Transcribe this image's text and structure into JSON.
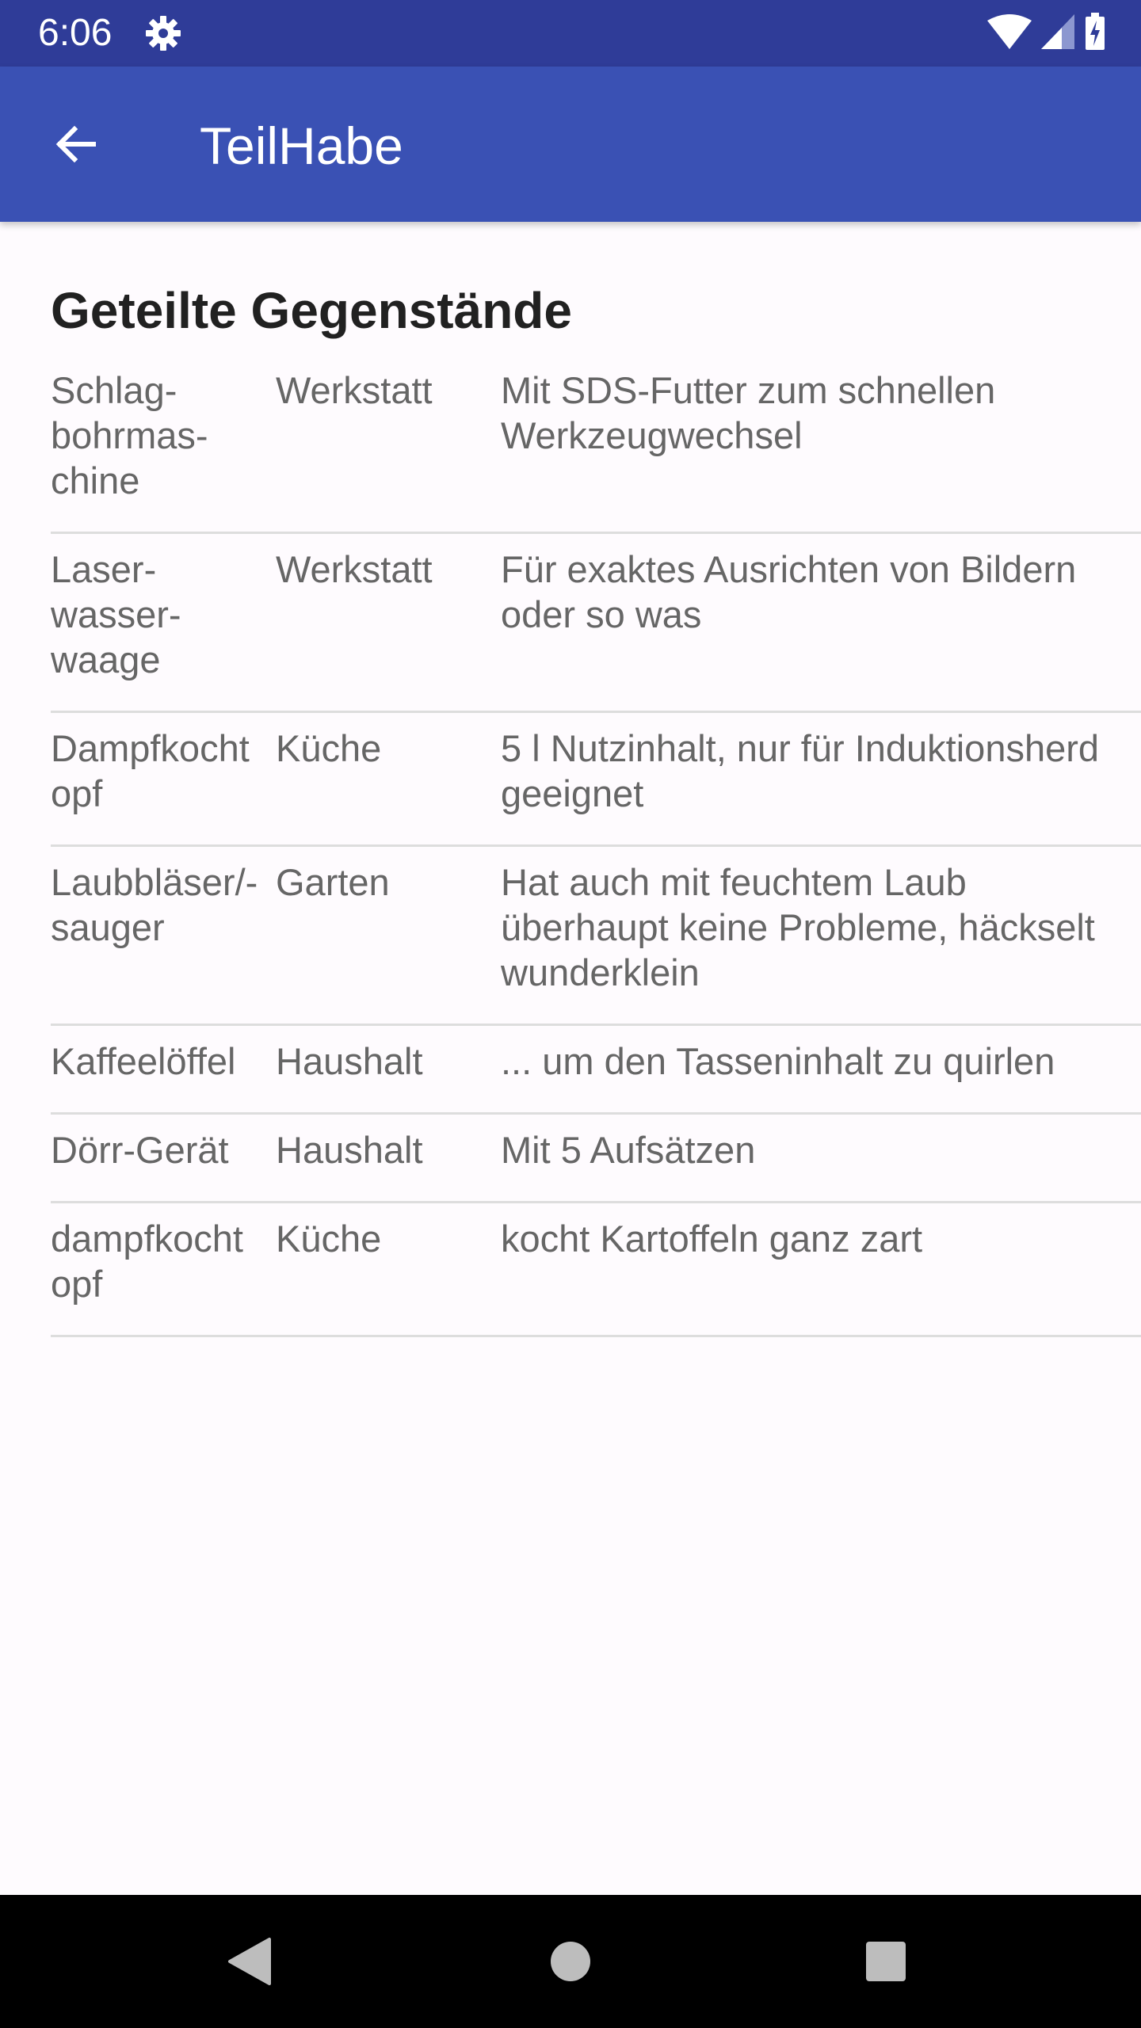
{
  "status_bar": {
    "time": "6:06",
    "icons": [
      "gear-icon",
      "wifi-icon",
      "signal-icon",
      "battery-icon"
    ]
  },
  "app_bar": {
    "title": "TeilHabe",
    "back_icon": "arrow-back-icon"
  },
  "main": {
    "section_title": "Geteilte Gegenstände",
    "items": [
      {
        "name": "Schlag-\nbohrmas-\nchine",
        "room": "Werkstatt",
        "description": "Mit SDS-Futter zum schnellen Werkzeugwechsel"
      },
      {
        "name": "Laser-\nwasser-\nwaage",
        "room": "Werkstatt",
        "description": "Für exaktes Ausrichten von Bildern oder so was"
      },
      {
        "name": "Dampfkocht\nopf",
        "room": "Küche",
        "description": "5 l Nutzinhalt, nur für Induktionsherd geeignet"
      },
      {
        "name": "Laubbläser/-\nsauger",
        "room": "Garten",
        "description": "Hat auch mit feuchtem Laub überhaupt keine Probleme, häckselt wunderklein"
      },
      {
        "name": "Kaffeelöffel",
        "room": "Haushalt",
        "description": "... um den Tasseninhalt zu quirlen"
      },
      {
        "name": "Dörr-Gerät",
        "room": "Haushalt",
        "description": "Mit 5 Aufsätzen"
      },
      {
        "name": "dampfkocht\nopf",
        "room": "Küche",
        "description": "kocht Kartoffeln ganz zart"
      }
    ]
  },
  "nav_bar": {
    "icons": [
      "back-triangle-icon",
      "home-circle-icon",
      "recents-square-icon"
    ]
  },
  "colors": {
    "status_bar": "#2f3c98",
    "app_bar": "#3a51b4",
    "background": "#fefbfe",
    "divider": "#dddddd",
    "text_secondary": "#666666",
    "text_primary": "#212121"
  }
}
